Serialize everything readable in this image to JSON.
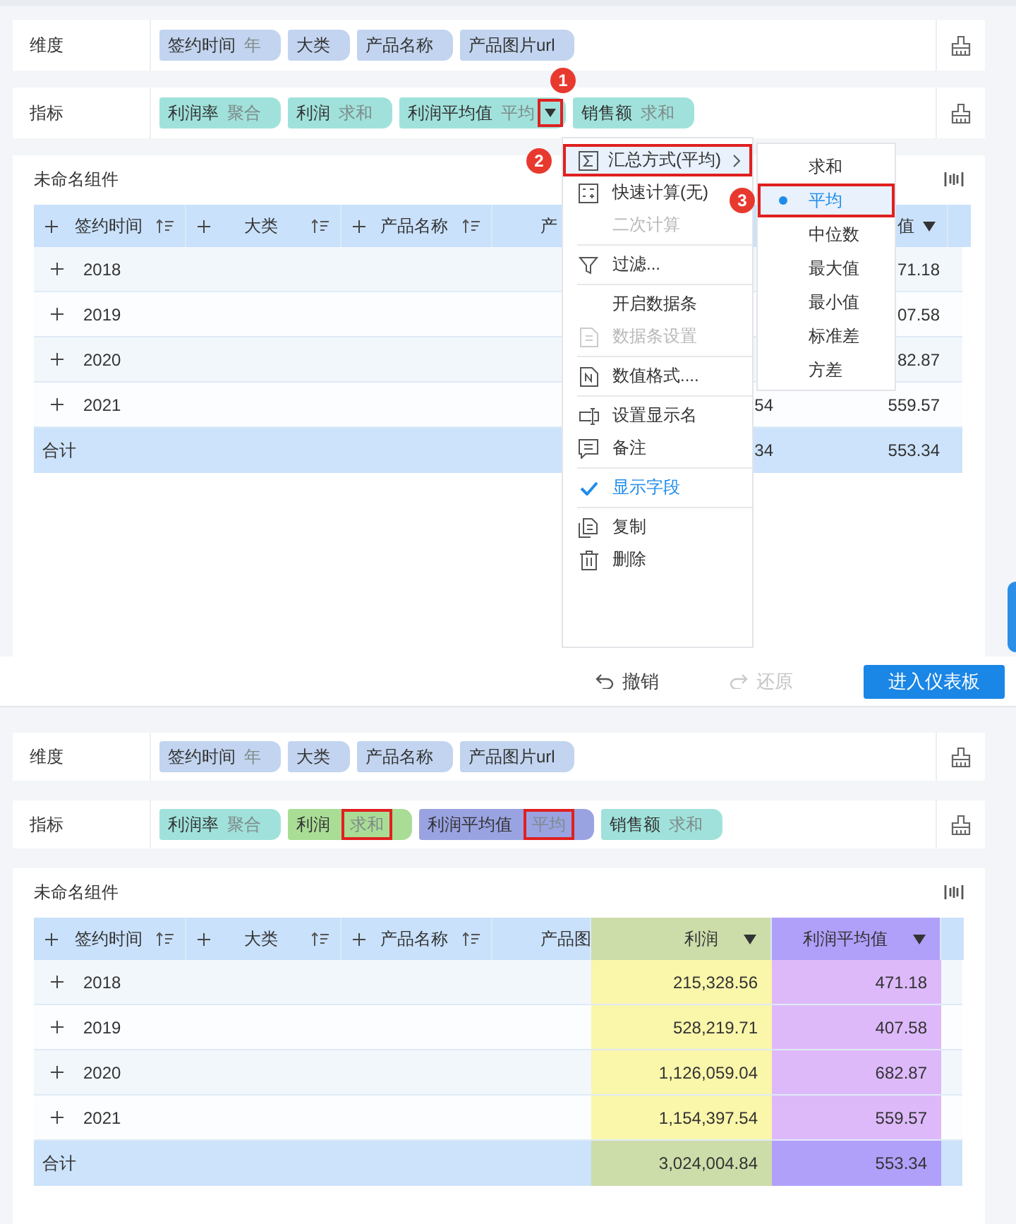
{
  "panels": [
    {
      "dimensions": {
        "label": "维度",
        "chips": [
          {
            "name": "签约时间",
            "sub": "年"
          },
          {
            "name": "大类"
          },
          {
            "name": "产品名称"
          },
          {
            "name": "产品图片url"
          }
        ]
      },
      "measures": {
        "label": "指标",
        "chips": [
          {
            "name": "利润率",
            "sub": "聚合",
            "color": "#a0e2db",
            "menu_open": false,
            "sub_outlined": false
          },
          {
            "name": "利润",
            "sub": "求和",
            "color": "#a0e2db",
            "menu_open": false,
            "sub_outlined": false
          },
          {
            "name": "利润平均值",
            "sub": "平均",
            "color": "#a0e2db",
            "menu_open": true,
            "step": "1",
            "sub_outlined": false
          },
          {
            "name": "销售额",
            "sub": "求和",
            "color": "#a0e2db",
            "menu_open": false,
            "sub_outlined": false
          }
        ]
      },
      "card": {
        "title": "未命名组件",
        "table": {
          "dimension_columns": [
            {
              "label": "签约时间"
            },
            {
              "label": "大类"
            },
            {
              "label": "产品名称"
            },
            {
              "label": "产"
            }
          ],
          "measure_columns": [
            {
              "label": "值"
            }
          ],
          "rows": [
            {
              "label": "2018",
              "values": [
                "71.18"
              ]
            },
            {
              "label": "2019",
              "values": [
                "07.58"
              ]
            },
            {
              "label": "2020",
              "values": [
                "82.87"
              ]
            },
            {
              "label": "2021",
              "values": [
                "54",
                "559.57"
              ]
            }
          ],
          "total": {
            "label": "合计",
            "values": [
              "34",
              "553.34"
            ]
          }
        }
      },
      "menu": {
        "groups": [
          {
            "items": [
              {
                "label": "汇总方式(平均)",
                "selected": true,
                "outlined": true,
                "step": "2",
                "has_submenu": true,
                "disabled": false,
                "checked": false
              },
              {
                "label": "快速计算(无)",
                "selected": false,
                "outlined": false,
                "has_submenu": false,
                "disabled": false,
                "checked": false
              },
              {
                "label": "二次计算",
                "selected": false,
                "outlined": false,
                "has_submenu": false,
                "disabled": true,
                "checked": false
              }
            ]
          },
          {
            "items": [
              {
                "label": "过滤...",
                "selected": false,
                "outlined": false,
                "has_submenu": false,
                "disabled": false,
                "checked": false
              }
            ]
          },
          {
            "items": [
              {
                "label": "开启数据条",
                "selected": false,
                "outlined": false,
                "has_submenu": false,
                "disabled": false,
                "checked": false
              },
              {
                "label": "数据条设置",
                "selected": false,
                "outlined": false,
                "has_submenu": false,
                "disabled": true,
                "checked": false
              }
            ]
          },
          {
            "items": [
              {
                "label": "数值格式....",
                "selected": false,
                "outlined": false,
                "has_submenu": false,
                "disabled": false,
                "checked": false
              }
            ]
          },
          {
            "items": [
              {
                "label": "设置显示名",
                "selected": false,
                "outlined": false,
                "has_submenu": false,
                "disabled": false,
                "checked": false
              },
              {
                "label": "备注",
                "selected": false,
                "outlined": false,
                "has_submenu": false,
                "disabled": false,
                "checked": false
              }
            ]
          },
          {
            "items": [
              {
                "label": "显示字段",
                "selected": false,
                "outlined": false,
                "has_submenu": false,
                "disabled": false,
                "checked": true
              }
            ]
          },
          {
            "items": [
              {
                "label": "复制",
                "selected": false,
                "outlined": false,
                "has_submenu": false,
                "disabled": false,
                "checked": false
              },
              {
                "label": "删除",
                "selected": false,
                "outlined": false,
                "has_submenu": false,
                "disabled": false,
                "checked": false
              }
            ]
          }
        ],
        "submenu": [
          {
            "label": "求和",
            "selected": false,
            "outlined": false
          },
          {
            "label": "平均",
            "selected": true,
            "outlined": true,
            "step": "3"
          },
          {
            "label": "中位数",
            "selected": false,
            "outlined": false
          },
          {
            "label": "最大值",
            "selected": false,
            "outlined": false
          },
          {
            "label": "最小值",
            "selected": false,
            "outlined": false
          },
          {
            "label": "标准差",
            "selected": false,
            "outlined": false
          },
          {
            "label": "方差",
            "selected": false,
            "outlined": false
          }
        ]
      },
      "toolbar": [
        {
          "kind": "undo",
          "label": "撤销",
          "disabled": false
        },
        {
          "kind": "redo",
          "label": "还原",
          "disabled": true
        },
        {
          "kind": "primary",
          "label": "进入仪表板",
          "disabled": false
        }
      ]
    },
    {
      "dimensions": {
        "label": "维度",
        "chips": [
          {
            "name": "签约时间",
            "sub": "年"
          },
          {
            "name": "大类"
          },
          {
            "name": "产品名称"
          },
          {
            "name": "产品图片url"
          }
        ]
      },
      "measures": {
        "label": "指标",
        "chips": [
          {
            "name": "利润率",
            "sub": "聚合",
            "color": "#a0e2db",
            "menu_open": false,
            "sub_outlined": false
          },
          {
            "name": "利润",
            "sub": "求和",
            "color": "#a9dd95",
            "menu_open": false,
            "sub_outlined": true
          },
          {
            "name": "利润平均值",
            "sub": "平均",
            "color": "#9aa3e2",
            "menu_open": false,
            "sub_outlined": true
          },
          {
            "name": "销售额",
            "sub": "求和",
            "color": "#a0e2db",
            "menu_open": false,
            "sub_outlined": false
          }
        ]
      },
      "card": {
        "title": "未命名组件",
        "table": {
          "dimension_columns": [
            {
              "label": "签约时间"
            },
            {
              "label": "大类"
            },
            {
              "label": "产品名称"
            },
            {
              "label": "产品图"
            }
          ],
          "measure_columns": [
            {
              "label": "利润",
              "color": "#faf6aa"
            },
            {
              "label": "利润平均值",
              "color": "#ddb9fa"
            }
          ],
          "rows": [
            {
              "label": "2018",
              "values": [
                "215,328.56",
                "471.18"
              ]
            },
            {
              "label": "2019",
              "values": [
                "528,219.71",
                "407.58"
              ]
            },
            {
              "label": "2020",
              "values": [
                "1,126,059.04",
                "682.87"
              ]
            },
            {
              "label": "2021",
              "values": [
                "1,154,397.54",
                "559.57"
              ]
            }
          ],
          "total": {
            "label": "合计",
            "values": [
              "3,024,004.84",
              "553.34"
            ]
          }
        }
      }
    }
  ]
}
